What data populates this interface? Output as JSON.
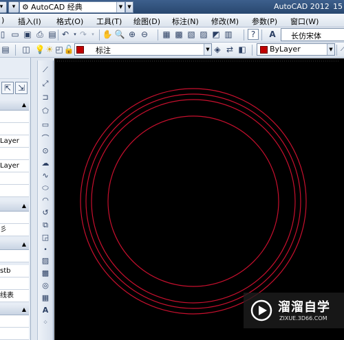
{
  "titlebar": {
    "workspace": "AutoCAD 经典",
    "app_title": "AutoCAD 2012",
    "title_suffix": "15"
  },
  "menu": {
    "items": [
      "插入(I)",
      "格式(O)",
      "工具(T)",
      "绘图(D)",
      "标注(N)",
      "修改(M)",
      "参数(P)",
      "窗口(W)"
    ],
    "leading_fragment": ")"
  },
  "toolbar": {
    "text_style": "长仿宋体"
  },
  "layer": {
    "current": "标注"
  },
  "color": {
    "current": "ByLayer",
    "swatch": "#c00000"
  },
  "palette": {
    "cells": [
      "Layer",
      "Layer",
      "彡",
      "stb",
      "线表"
    ]
  },
  "canvas": {
    "background": "#000000",
    "circle_color": "#c8102e"
  },
  "watermark": {
    "title": "溜溜自学",
    "url": "ZIXUE.3D66.COM"
  }
}
